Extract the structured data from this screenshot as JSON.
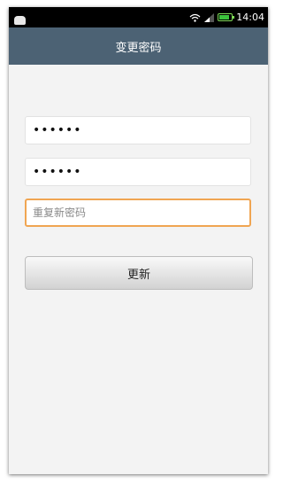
{
  "status_bar": {
    "time": "14:04",
    "battery_level": 0.85,
    "icons": [
      "notification-icon",
      "wifi-icon",
      "signal-icon",
      "battery-icon"
    ]
  },
  "header": {
    "title": "变更密码"
  },
  "form": {
    "new_password_value": "••••••",
    "confirm_password_value": "••••••",
    "repeat_password_placeholder": "重复新密码",
    "submit_label": "更新"
  },
  "colors": {
    "title_bar": "#4c6274",
    "focus_border": "#f0a552",
    "battery": "#3cc33c"
  }
}
